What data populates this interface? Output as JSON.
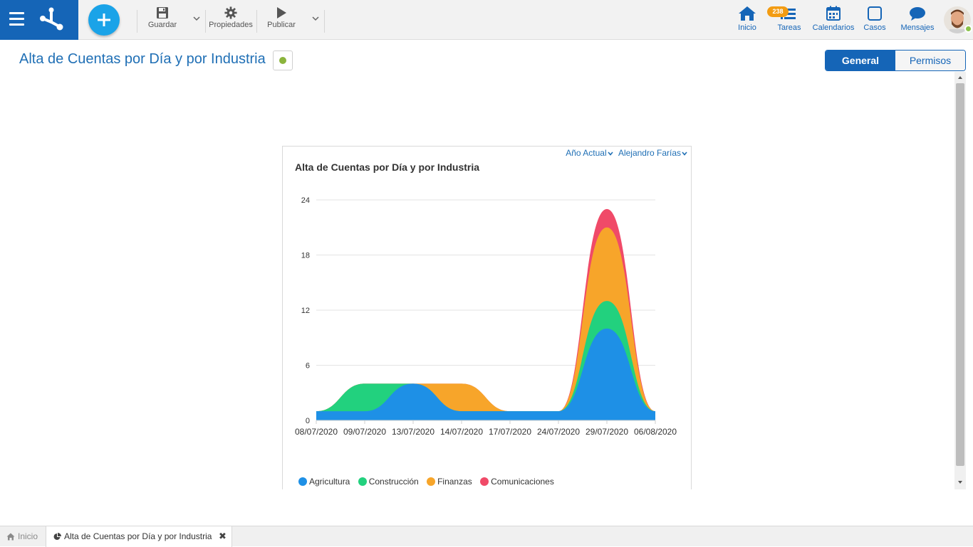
{
  "toolbar": {
    "save_label": "Guardar",
    "properties_label": "Propiedades",
    "publish_label": "Publicar"
  },
  "nav": {
    "home_label": "Inicio",
    "tasks_label": "Tareas",
    "tasks_count": "238",
    "calendars_label": "Calendarios",
    "cases_label": "Casos",
    "messages_label": "Mensajes"
  },
  "page": {
    "title": "Alta de Cuentas por Día y por Industria",
    "tabs": [
      {
        "label": "General",
        "active": true
      },
      {
        "label": "Permisos",
        "active": false
      }
    ]
  },
  "chart_filters": {
    "period": "Año Actual",
    "user": "Alejandro Farías"
  },
  "chart_data": {
    "type": "area",
    "stacked": true,
    "title": "Alta de Cuentas por Día y por Industria",
    "categories": [
      "08/07/2020",
      "09/07/2020",
      "13/07/2020",
      "14/07/2020",
      "17/07/2020",
      "24/07/2020",
      "29/07/2020",
      "06/08/2020"
    ],
    "yticks": [
      0,
      6,
      12,
      18,
      24
    ],
    "ylim": [
      0,
      24
    ],
    "grid": true,
    "legend_position": "bottom-left",
    "series": [
      {
        "name": "Agricultura",
        "color": "#1e90e6",
        "values": [
          1,
          1,
          4,
          1,
          1,
          1,
          10,
          1
        ]
      },
      {
        "name": "Construcción",
        "color": "#22d17e",
        "values": [
          0,
          3,
          0,
          0,
          0,
          0,
          3,
          0
        ]
      },
      {
        "name": "Finanzas",
        "color": "#f7a52a",
        "values": [
          0,
          0,
          0,
          3,
          0,
          0,
          8,
          0
        ]
      },
      {
        "name": "Comunicaciones",
        "color": "#f04a68",
        "values": [
          0,
          0,
          0,
          0,
          0,
          0,
          2,
          0
        ]
      }
    ]
  },
  "bottom_tabs": {
    "home_label": "Inicio",
    "active_label": "Alta de Cuentas por Día y por Industria"
  },
  "colors": {
    "brand": "#1565b7",
    "accent": "#1aa3e8",
    "status": "#8bb43c",
    "badge": "#f39c12"
  }
}
